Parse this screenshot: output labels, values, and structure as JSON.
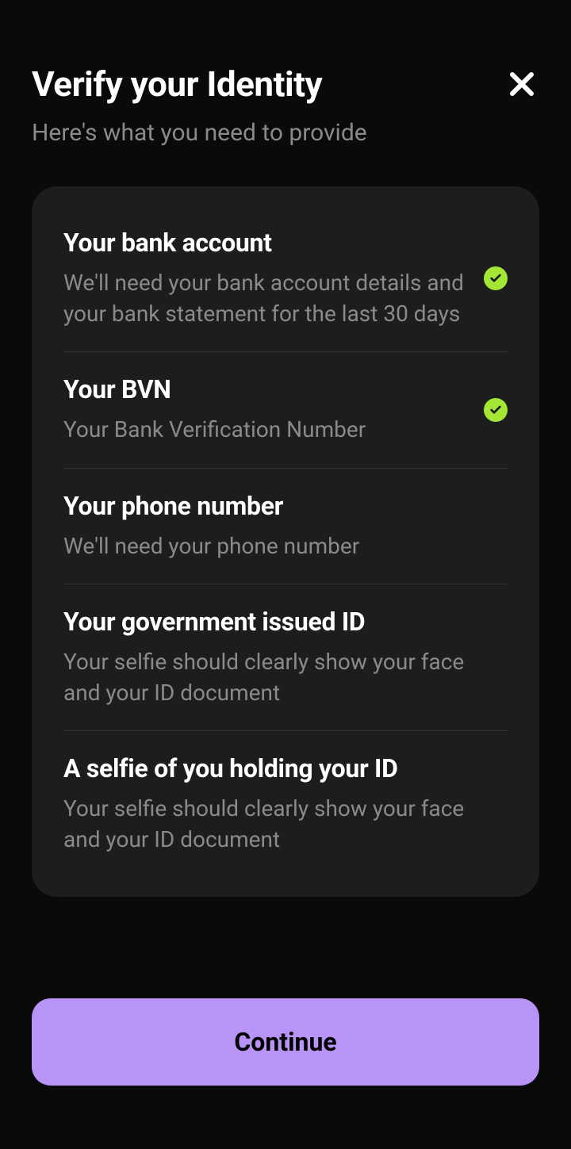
{
  "header": {
    "title": "Verify your Identity",
    "subtitle": "Here's what you need to provide"
  },
  "items": [
    {
      "title": "Your bank account",
      "description": "We'll need your bank account details and your bank statement for the last 30 days",
      "completed": true
    },
    {
      "title": "Your BVN",
      "description": "Your Bank Verification Number",
      "completed": true
    },
    {
      "title": "Your phone number",
      "description": "We'll need your phone number",
      "completed": false
    },
    {
      "title": "Your government issued ID",
      "description": "Your selfie should clearly show your face and your ID document",
      "completed": false
    },
    {
      "title": "A selfie of you holding your ID",
      "description": "Your selfie should clearly show your face and your ID document",
      "completed": false
    }
  ],
  "button": {
    "continue_label": "Continue"
  },
  "colors": {
    "accent": "#a3e635",
    "primary_button": "#b794f6",
    "card_bg": "#1d1d1d",
    "page_bg": "#0a0a0a"
  }
}
